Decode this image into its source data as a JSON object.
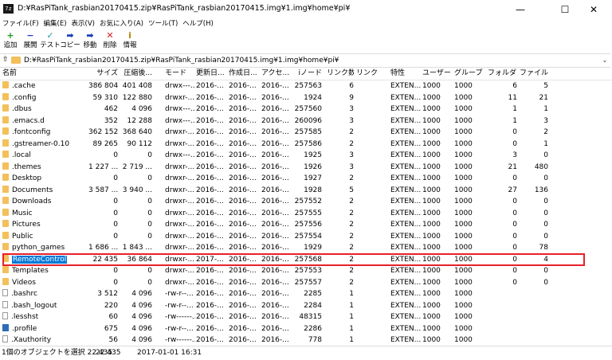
{
  "window": {
    "app_icon": "7z",
    "title": "D:¥RasPiTank_rasbian20170415.zip¥RasPiTank_rasbian20170415.img¥1.img¥home¥pi¥",
    "minimize_glyph": "—",
    "maximize_glyph": "☐",
    "close_glyph": "✕"
  },
  "menu": [
    "ファイル(F)",
    "編集(E)",
    "表示(V)",
    "お気に入り(A)",
    "ツール(T)",
    "ヘルプ(H)"
  ],
  "toolbar": [
    {
      "icon": "add-icon",
      "glyph": "+",
      "color": "#1a9c1a",
      "label": "追加"
    },
    {
      "icon": "extract-icon",
      "glyph": "−",
      "color": "#1e3fbf",
      "label": "展開"
    },
    {
      "icon": "test-icon",
      "glyph": "✓",
      "color": "#16a0a0",
      "label": "テスト"
    },
    {
      "icon": "copy-icon",
      "glyph": "➡",
      "color": "#1e3fbf",
      "label": "コピー"
    },
    {
      "icon": "move-icon",
      "glyph": "➡",
      "color": "#1e3fbf",
      "label": "移動"
    },
    {
      "icon": "delete-icon",
      "glyph": "✕",
      "color": "#d02020",
      "label": "削除"
    },
    {
      "icon": "info-icon",
      "glyph": "i",
      "color": "#b08a00",
      "label": "情報"
    }
  ],
  "address": {
    "path": "D:¥RasPiTank_rasbian20170415.zip¥RasPiTank_rasbian20170415.img¥1.img¥home¥pi¥",
    "dropdown_glyph": "⌄",
    "up_glyph": "⇧"
  },
  "columns": {
    "name": "名前",
    "size": "サイズ",
    "packed": "圧縮後...",
    "mode": "モード",
    "modified": "更新日...",
    "created": "作成日...",
    "accessed": "アクセ...",
    "inode": "iノード",
    "links_count": "リンク数",
    "link": "リンク",
    "attr": "特性",
    "user": "ユーザー",
    "group": "グループ",
    "folders": "フォルダ...",
    "files": "ファイル..."
  },
  "rows": [
    {
      "icon": "folder",
      "name": ".cache",
      "size": "386 804",
      "packed": "401 408",
      "mode": "drwx---...",
      "modified": "2016-...",
      "created": "2016-...",
      "accessed": "2016-...",
      "inode": "257563",
      "links": "6",
      "attr": "EXTEN...",
      "user": "1000",
      "group": "1000",
      "folders": "6",
      "files": "5"
    },
    {
      "icon": "folder",
      "name": ".config",
      "size": "59 310",
      "packed": "122 880",
      "mode": "drwxr-...",
      "modified": "2016-...",
      "created": "2016-...",
      "accessed": "2016-...",
      "inode": "1924",
      "links": "9",
      "attr": "EXTEN...",
      "user": "1000",
      "group": "1000",
      "folders": "11",
      "files": "21"
    },
    {
      "icon": "folder",
      "name": ".dbus",
      "size": "462",
      "packed": "4 096",
      "mode": "drwx---...",
      "modified": "2016-...",
      "created": "2016-...",
      "accessed": "2016-...",
      "inode": "257560",
      "links": "3",
      "attr": "EXTEN...",
      "user": "1000",
      "group": "1000",
      "folders": "1",
      "files": "1"
    },
    {
      "icon": "folder",
      "name": ".emacs.d",
      "size": "352",
      "packed": "12 288",
      "mode": "drwx---...",
      "modified": "2016-...",
      "created": "2016-...",
      "accessed": "2016-...",
      "inode": "260096",
      "links": "3",
      "attr": "EXTEN...",
      "user": "1000",
      "group": "1000",
      "folders": "1",
      "files": "3"
    },
    {
      "icon": "folder",
      "name": ".fontconfig",
      "size": "362 152",
      "packed": "368 640",
      "mode": "drwxr-...",
      "modified": "2016-...",
      "created": "2016-...",
      "accessed": "2016-...",
      "inode": "257585",
      "links": "2",
      "attr": "EXTEN...",
      "user": "1000",
      "group": "1000",
      "folders": "0",
      "files": "2"
    },
    {
      "icon": "folder",
      "name": ".gstreamer-0.10",
      "size": "89 265",
      "packed": "90 112",
      "mode": "drwxr-...",
      "modified": "2016-...",
      "created": "2016-...",
      "accessed": "2016-...",
      "inode": "257586",
      "links": "2",
      "attr": "EXTEN...",
      "user": "1000",
      "group": "1000",
      "folders": "0",
      "files": "1"
    },
    {
      "icon": "folder",
      "name": ".local",
      "size": "0",
      "packed": "0",
      "mode": "drwx---...",
      "modified": "2016-...",
      "created": "2016-...",
      "accessed": "2016-...",
      "inode": "1925",
      "links": "3",
      "attr": "EXTEN...",
      "user": "1000",
      "group": "1000",
      "folders": "3",
      "files": "0"
    },
    {
      "icon": "folder",
      "name": ".themes",
      "size": "1 227 ...",
      "packed": "2 719 ...",
      "mode": "drwxr-...",
      "modified": "2016-...",
      "created": "2016-...",
      "accessed": "2016-...",
      "inode": "1926",
      "links": "3",
      "attr": "EXTEN...",
      "user": "1000",
      "group": "1000",
      "folders": "21",
      "files": "480"
    },
    {
      "icon": "folder",
      "name": "Desktop",
      "size": "0",
      "packed": "0",
      "mode": "drwxr-...",
      "modified": "2016-...",
      "created": "2016-...",
      "accessed": "2016-...",
      "inode": "1927",
      "links": "2",
      "attr": "EXTEN...",
      "user": "1000",
      "group": "1000",
      "folders": "0",
      "files": "0"
    },
    {
      "icon": "folder",
      "name": "Documents",
      "size": "3 587 ...",
      "packed": "3 940 ...",
      "mode": "drwxr-...",
      "modified": "2016-...",
      "created": "2016-...",
      "accessed": "2016-...",
      "inode": "1928",
      "links": "5",
      "attr": "EXTEN...",
      "user": "1000",
      "group": "1000",
      "folders": "27",
      "files": "136"
    },
    {
      "icon": "folder",
      "name": "Downloads",
      "size": "0",
      "packed": "0",
      "mode": "drwxr-...",
      "modified": "2016-...",
      "created": "2016-...",
      "accessed": "2016-...",
      "inode": "257552",
      "links": "2",
      "attr": "EXTEN...",
      "user": "1000",
      "group": "1000",
      "folders": "0",
      "files": "0"
    },
    {
      "icon": "folder",
      "name": "Music",
      "size": "0",
      "packed": "0",
      "mode": "drwxr-...",
      "modified": "2016-...",
      "created": "2016-...",
      "accessed": "2016-...",
      "inode": "257555",
      "links": "2",
      "attr": "EXTEN...",
      "user": "1000",
      "group": "1000",
      "folders": "0",
      "files": "0"
    },
    {
      "icon": "folder",
      "name": "Pictures",
      "size": "0",
      "packed": "0",
      "mode": "drwxr-...",
      "modified": "2016-...",
      "created": "2016-...",
      "accessed": "2016-...",
      "inode": "257556",
      "links": "2",
      "attr": "EXTEN...",
      "user": "1000",
      "group": "1000",
      "folders": "0",
      "files": "0"
    },
    {
      "icon": "folder",
      "name": "Public",
      "size": "0",
      "packed": "0",
      "mode": "drwxr-...",
      "modified": "2016-...",
      "created": "2016-...",
      "accessed": "2016-...",
      "inode": "257554",
      "links": "2",
      "attr": "EXTEN...",
      "user": "1000",
      "group": "1000",
      "folders": "0",
      "files": "0"
    },
    {
      "icon": "folder",
      "name": "python_games",
      "size": "1 686 ...",
      "packed": "1 843 ...",
      "mode": "drwxr-...",
      "modified": "2016-...",
      "created": "2016-...",
      "accessed": "2016-...",
      "inode": "1929",
      "links": "2",
      "attr": "EXTEN...",
      "user": "1000",
      "group": "1000",
      "folders": "0",
      "files": "78"
    },
    {
      "icon": "folder",
      "name": "RemoteControl",
      "size": "22 435",
      "packed": "36 864",
      "mode": "drwxr-...",
      "modified": "2017-...",
      "created": "2016-...",
      "accessed": "2016-...",
      "inode": "257568",
      "links": "2",
      "attr": "EXTEN...",
      "user": "1000",
      "group": "1000",
      "folders": "0",
      "files": "4",
      "selected": true
    },
    {
      "icon": "folder",
      "name": "Templates",
      "size": "0",
      "packed": "0",
      "mode": "drwxr-...",
      "modified": "2016-...",
      "created": "2016-...",
      "accessed": "2016-...",
      "inode": "257553",
      "links": "2",
      "attr": "EXTEN...",
      "user": "1000",
      "group": "1000",
      "folders": "0",
      "files": "0"
    },
    {
      "icon": "folder",
      "name": "Videos",
      "size": "0",
      "packed": "0",
      "mode": "drwxr-...",
      "modified": "2016-...",
      "created": "2016-...",
      "accessed": "2016-...",
      "inode": "257557",
      "links": "2",
      "attr": "EXTEN...",
      "user": "1000",
      "group": "1000",
      "folders": "0",
      "files": "0"
    },
    {
      "icon": "file",
      "name": ".bashrc",
      "size": "3 512",
      "packed": "4 096",
      "mode": "-rw-r--...",
      "modified": "2016-...",
      "created": "2016-...",
      "accessed": "2016-...",
      "inode": "2285",
      "links": "1",
      "attr": "EXTEN...",
      "user": "1000",
      "group": "1000",
      "folders": "",
      "files": ""
    },
    {
      "icon": "file",
      "name": ".bash_logout",
      "size": "220",
      "packed": "4 096",
      "mode": "-rw-r--...",
      "modified": "2016-...",
      "created": "2016-...",
      "accessed": "2016-...",
      "inode": "2284",
      "links": "1",
      "attr": "EXTEN...",
      "user": "1000",
      "group": "1000",
      "folders": "",
      "files": ""
    },
    {
      "icon": "file",
      "name": ".lesshst",
      "size": "60",
      "packed": "4 096",
      "mode": "-rw------...",
      "modified": "2016-...",
      "created": "2016-...",
      "accessed": "2016-...",
      "inode": "48315",
      "links": "1",
      "attr": "EXTEN...",
      "user": "1000",
      "group": "1000",
      "folders": "",
      "files": ""
    },
    {
      "icon": "profile",
      "name": ".profile",
      "size": "675",
      "packed": "4 096",
      "mode": "-rw-r--...",
      "modified": "2016-...",
      "created": "2016-...",
      "accessed": "2016-...",
      "inode": "2286",
      "links": "1",
      "attr": "EXTEN...",
      "user": "1000",
      "group": "1000",
      "folders": "",
      "files": ""
    },
    {
      "icon": "file",
      "name": ".Xauthority",
      "size": "56",
      "packed": "4 096",
      "mode": "-rw------...",
      "modified": "2016-...",
      "created": "2016-...",
      "accessed": "2016-...",
      "inode": "778",
      "links": "1",
      "attr": "EXTEN...",
      "user": "1000",
      "group": "1000",
      "folders": "",
      "files": ""
    }
  ],
  "status": {
    "selection": "1個のオブジェクトを選択 22 435",
    "size": "22 435",
    "date": "2017-01-01 16:31"
  },
  "colors": {
    "selection": "#0078d7",
    "highlight_box": "#e8202a",
    "folder": "#f3c05a"
  }
}
